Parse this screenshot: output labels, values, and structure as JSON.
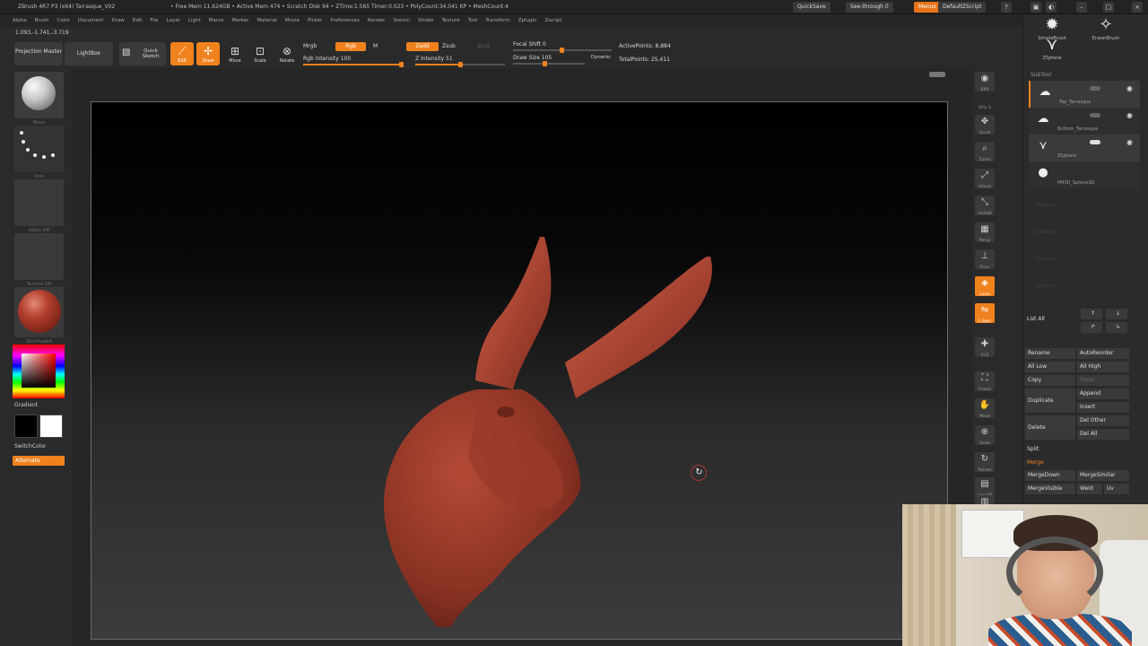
{
  "titlebar": {
    "title": "ZBrush 4R7 P3 (x64)    Tarrasque_V02",
    "stats": "• Free Mem 11.624GB • Active Mem 474 • Scratch Disk 94 • ZTime:1.565 Timer:0.023 • PolyCount:34.041 KP • MeshCount:4",
    "quicksave": "QuickSave",
    "seethrough": "See-through  0",
    "menus": "Menus",
    "script": "DefaultZScript"
  },
  "menu": [
    "Alpha",
    "Brush",
    "Color",
    "Document",
    "Draw",
    "Edit",
    "File",
    "Layer",
    "Light",
    "Macro",
    "Marker",
    "Material",
    "Movie",
    "Picker",
    "Preferences",
    "Render",
    "Stencil",
    "Stroke",
    "Texture",
    "Tool",
    "Transform",
    "Zplugin",
    "Zscript"
  ],
  "coords": "1.093,-1.741,-3.719",
  "toolbar": {
    "projection_master": "Projection Master",
    "lightbox": "LightBox",
    "quick_sketch": "Quick Sketch",
    "edit": "Edit",
    "draw": "Draw",
    "move": "Move",
    "scale": "Scale",
    "rotate": "Rotate",
    "mrgb": "Mrgb",
    "rgb": "Rgb",
    "m": "M",
    "rgb_intensity": "Rgb Intensity 100",
    "zadd": "Zadd",
    "zsub": "Zsub",
    "zcut": "Zcut",
    "z_intensity": "Z Intensity 51",
    "focal_shift": "Focal Shift 0",
    "draw_size": "Draw Size 105",
    "dynamic": "Dynamic",
    "active_points": "ActivePoints: 8,884",
    "total_points": "TotalPoints: 25,411",
    "rgb_intensity_level": 1.0,
    "z_intensity_level": 0.51
  },
  "left": {
    "brush_cap": "Move",
    "stroke_cap": "Dots",
    "alpha_cap": "Alpha Off",
    "texture_cap": "Texture Off",
    "material_cap": "SkinShade4",
    "gradient": "Gradient",
    "switchcolor": "SwitchColor",
    "alternate": "Alternate"
  },
  "rtools": [
    {
      "icon": "bpr-icon",
      "glyph": "◉",
      "label": "BPR"
    },
    {
      "icon": "spix-icon",
      "glyph": "",
      "label": "SPix 3"
    },
    {
      "icon": "scroll-icon",
      "glyph": "✥",
      "label": "Scroll"
    },
    {
      "icon": "zoom-icon",
      "glyph": "⌕",
      "label": "Zoom"
    },
    {
      "icon": "actual-icon",
      "glyph": "⤢",
      "label": "Actual"
    },
    {
      "icon": "aahalf-icon",
      "glyph": "⤡",
      "label": "AAHalf"
    },
    {
      "icon": "persp-icon",
      "glyph": "▦",
      "label": "Persp"
    },
    {
      "icon": "floor-icon",
      "glyph": "⊥",
      "label": "Floor"
    },
    {
      "icon": "local-icon",
      "glyph": "◈",
      "label": "Local"
    },
    {
      "icon": "lsym-icon",
      "glyph": "⇋",
      "label": "L.Sym"
    },
    {
      "icon": "xyz-icon",
      "glyph": "✚",
      "label": "XYZ"
    },
    {
      "icon": "frame-icon",
      "glyph": "⛶",
      "label": "Frame"
    },
    {
      "icon": "move-icon",
      "glyph": "✋",
      "label": "Move"
    },
    {
      "icon": "scale-icon",
      "glyph": "⊕",
      "label": "Scale"
    },
    {
      "icon": "rotate-icon",
      "glyph": "↻",
      "label": "Rotate"
    },
    {
      "icon": "linefill-icon",
      "glyph": "▤",
      "label": "Line Fill"
    },
    {
      "icon": "polyf-icon",
      "glyph": "▥",
      "label": "PolyF"
    }
  ],
  "rpanel": {
    "simplebrush": "SimpleBrush",
    "eraserbrush": "EraserBrush",
    "zsphere": "ZSphere",
    "subtool": "SubTool",
    "rows": [
      {
        "name": "Top_Tarrasque"
      },
      {
        "name": "Bottom_Tarrasque"
      },
      {
        "name": "ZSphere"
      },
      {
        "name": "PM3D_Sphere3D"
      }
    ],
    "empty": [
      "Subtool 4",
      "Subtool 5",
      "Subtool 6",
      "Subtool 7"
    ],
    "list_all": "List All",
    "rename": "Rename",
    "autoreorder": "AutoReorder",
    "all_low": "All Low",
    "all_high": "All High",
    "copy": "Copy",
    "paste": "Paste",
    "duplicate": "Duplicate",
    "append": "Append",
    "insert": "Insert",
    "delete": "Delete",
    "del_other": "Del Other",
    "del_all": "Del All",
    "split": "Split",
    "merge": "Merge",
    "mergedown": "MergeDown",
    "mergesimilar": "MergeSimilar",
    "mergevisible": "MergeVisible",
    "weld": "Weld",
    "uv": "Uv"
  },
  "colors": {
    "accent": "#f0821e",
    "model": "#8c3324"
  }
}
